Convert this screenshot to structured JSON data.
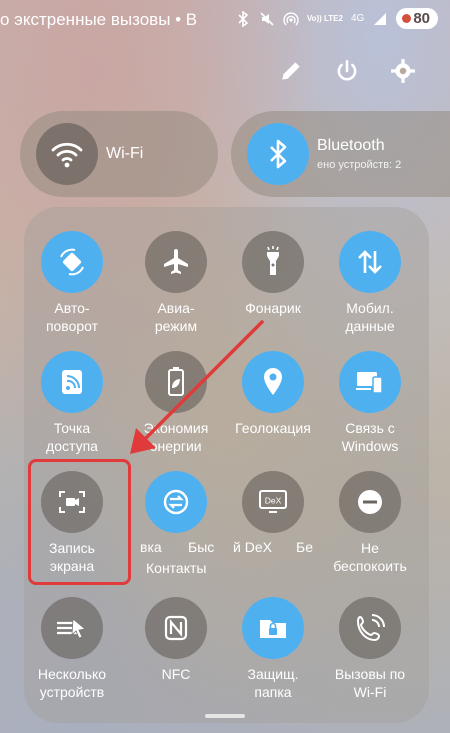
{
  "status_bar": {
    "text": "о экстренные вызовы • В",
    "network": "Vo)) LTE2",
    "network_gen": "4G",
    "battery": "80",
    "icons": [
      "bluetooth-icon",
      "mute-icon",
      "hotspot-icon",
      "signal-icon"
    ]
  },
  "header_actions": [
    "edit-icon",
    "power-icon",
    "settings-icon"
  ],
  "wifi": {
    "label": "Wi-Fi",
    "icon": "wifi-icon"
  },
  "bluetooth": {
    "label": "Bluetooth",
    "sub": "ено устройств: 2",
    "icon": "bluetooth-icon"
  },
  "tiles": {
    "autorotate": {
      "line1": "Авто-",
      "line2": "поворот",
      "active": true
    },
    "airplane": {
      "line1": "Авиа-",
      "line2": "режим",
      "active": false
    },
    "flashlight": {
      "line1": "Фонарик",
      "line2": "",
      "active": false
    },
    "mobile_data": {
      "line1": "Мобил.",
      "line2": "данные",
      "active": true
    },
    "hotspot": {
      "line1": "Точка",
      "line2": "доступа",
      "active": true
    },
    "power_saving": {
      "line1": "Экономия",
      "line2": "энергии",
      "active": false
    },
    "location": {
      "line1": "Геолокация",
      "line2": "",
      "active": true
    },
    "link_windows": {
      "line1": "Связь с",
      "line2": "Windows",
      "active": true
    },
    "screen_record": {
      "line1": "Запись",
      "line2": "экрана",
      "active": false
    },
    "quick_share": {
      "line1": "вка",
      "line2": "Быс",
      "active": true
    },
    "dex": {
      "line1": "й DeX",
      "line2": "Бе",
      "active": false
    },
    "dnd": {
      "line1": "Не",
      "line2": "беспокоить",
      "active": false
    },
    "multi_device": {
      "line1": "Несколько",
      "line2": "устройств",
      "active": false
    },
    "nfc": {
      "line1": "NFC",
      "line2": "",
      "active": false
    },
    "secure_folder": {
      "line1": "Защищ.",
      "line2": "папка",
      "active": true
    },
    "wifi_calling": {
      "line1": "Вызовы по",
      "line2": "Wi-Fi",
      "active": false
    }
  },
  "contacts_label": "Контакты",
  "colors": {
    "accent": "#4fb0f0",
    "highlight": "#e03a3a"
  }
}
